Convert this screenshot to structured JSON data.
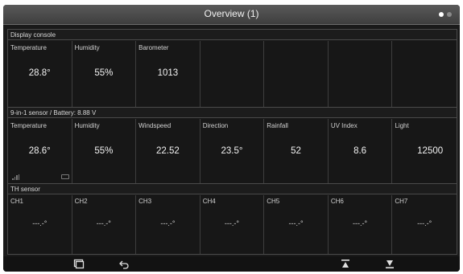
{
  "title": "Overview (1)",
  "page_indicator": {
    "pages": 2,
    "active": 1
  },
  "display_console": {
    "header": "Display console",
    "cells": [
      {
        "label": "Temperature",
        "value": "28.8°"
      },
      {
        "label": "Humidity",
        "value": "55%"
      },
      {
        "label": "Barometer",
        "value": "1013"
      },
      {
        "label": "",
        "value": ""
      },
      {
        "label": "",
        "value": ""
      },
      {
        "label": "",
        "value": ""
      },
      {
        "label": "",
        "value": ""
      }
    ]
  },
  "sensor_9in1": {
    "header": "9-in-1 sensor / Battery: 8.88 V",
    "cells": [
      {
        "label": "Temperature",
        "value": "28.6°"
      },
      {
        "label": "Humidity",
        "value": "55%"
      },
      {
        "label": "Windspeed",
        "value": "22.52"
      },
      {
        "label": "Direction",
        "value": "23.5°"
      },
      {
        "label": "Rainfall",
        "value": "52"
      },
      {
        "label": "UV Index",
        "value": "8.6"
      },
      {
        "label": "Light",
        "value": "12500"
      }
    ]
  },
  "th_sensor": {
    "header": "TH sensor",
    "cells": [
      {
        "label": "CH1",
        "value": "---.-°"
      },
      {
        "label": "CH2",
        "value": "---.-°"
      },
      {
        "label": "CH3",
        "value": "---.-°"
      },
      {
        "label": "CH4",
        "value": "---.-°"
      },
      {
        "label": "CH5",
        "value": "---.-°"
      },
      {
        "label": "CH6",
        "value": "---.-°"
      },
      {
        "label": "CH7",
        "value": "---.-°"
      }
    ]
  },
  "toolbar": {
    "icons": [
      "switch-view-icon",
      "back-icon",
      "page-up-icon",
      "page-down-icon"
    ]
  },
  "colors": {
    "background": "#1a1a1a",
    "titlebar": "#4a4a4a",
    "grid_line": "#4a4a4a",
    "text": "#f2f2f2"
  }
}
